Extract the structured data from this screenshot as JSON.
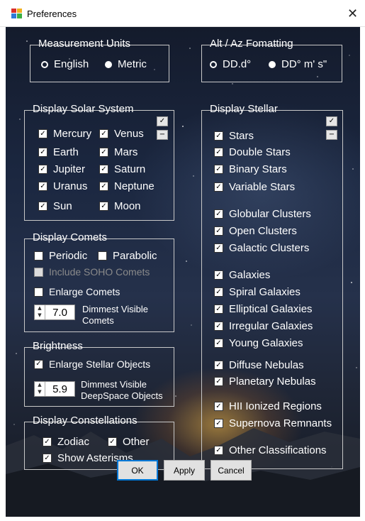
{
  "window": {
    "title": "Preferences",
    "close_glyph": "✕",
    "icon": "app-grid-icon"
  },
  "measurement": {
    "title": "Measurement Units",
    "english": "English",
    "metric": "Metric",
    "selected": "English"
  },
  "altaz": {
    "title": "Alt / Az Fomatting",
    "opt1": "DD.d°",
    "opt2": "DD° m' s\"",
    "selected": "DD.d°"
  },
  "solar": {
    "title": "Display Solar System",
    "check_all": "✓",
    "uncheck_all": "−",
    "items": {
      "mercury": "Mercury",
      "venus": "Venus",
      "earth": "Earth",
      "mars": "Mars",
      "jupiter": "Jupiter",
      "saturn": "Saturn",
      "uranus": "Uranus",
      "neptune": "Neptune",
      "sun": "Sun",
      "moon": "Moon"
    }
  },
  "comets": {
    "title": "Display Comets",
    "periodic": "Periodic",
    "parabolic": "Parabolic",
    "soho": "Include SOHO Comets",
    "enlarge": "Enlarge Comets",
    "dimmest_value": "7.0",
    "dimmest_label_1": "Dimmest Visible",
    "dimmest_label_2": "Comets"
  },
  "brightness": {
    "title": "Brightness",
    "enlarge": "Enlarge Stellar Objects",
    "dimmest_value": "5.9",
    "dimmest_label_1": "Dimmest Visible",
    "dimmest_label_2": "DeepSpace Objects"
  },
  "constellations": {
    "title": "Display Constellations",
    "zodiac": "Zodiac",
    "other": "Other",
    "asterisms": "Show Asterisms"
  },
  "stellar": {
    "title": "Display Stellar",
    "check_all": "✓",
    "uncheck_all": "−",
    "items": {
      "stars": "Stars",
      "double": "Double Stars",
      "binary": "Binary Stars",
      "variable": "Variable Stars",
      "globular": "Globular Clusters",
      "open": "Open Clusters",
      "galactic": "Galactic Clusters",
      "galaxies": "Galaxies",
      "spiral": "Spiral Galaxies",
      "elliptical": "Elliptical Galaxies",
      "irregular": "Irregular Galaxies",
      "young": "Young Galaxies",
      "diffuse": "Diffuse Nebulas",
      "planetary": "Planetary Nebulas",
      "hii": "HII Ionized Regions",
      "supernova": "Supernova Remnants",
      "other": "Other Classifications"
    }
  },
  "buttons": {
    "ok": "OK",
    "apply": "Apply",
    "cancel": "Cancel"
  },
  "check_glyph": "✓"
}
